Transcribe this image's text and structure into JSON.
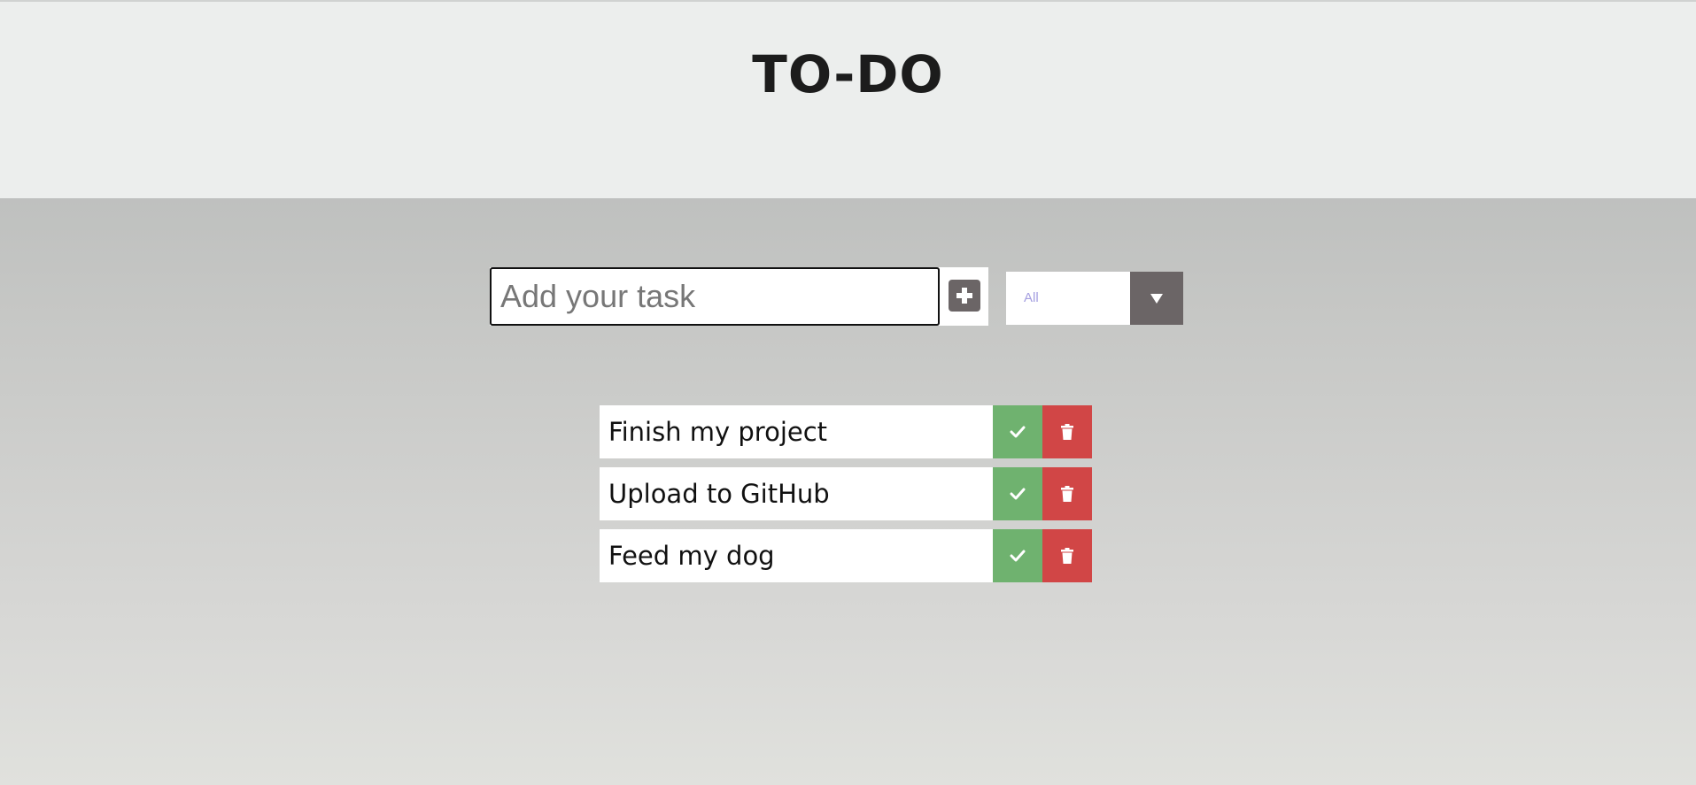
{
  "header": {
    "title": "TO-DO"
  },
  "task_form": {
    "input_placeholder": "Add your task",
    "input_value": "",
    "add_icon": "plus-square-icon"
  },
  "filter": {
    "selected": "All",
    "arrow_icon": "caret-down-icon"
  },
  "todos": [
    {
      "text": "Finish my project"
    },
    {
      "text": "Upload to GitHub"
    },
    {
      "text": "Feed my dog"
    }
  ],
  "icons": {
    "complete": "check-icon",
    "delete": "trash-icon"
  },
  "colors": {
    "header_bg": "#eceeed",
    "complete": "#6fb26f",
    "delete": "#d14646",
    "control_dark": "#6b6566",
    "filter_text": "#a59fe0"
  }
}
